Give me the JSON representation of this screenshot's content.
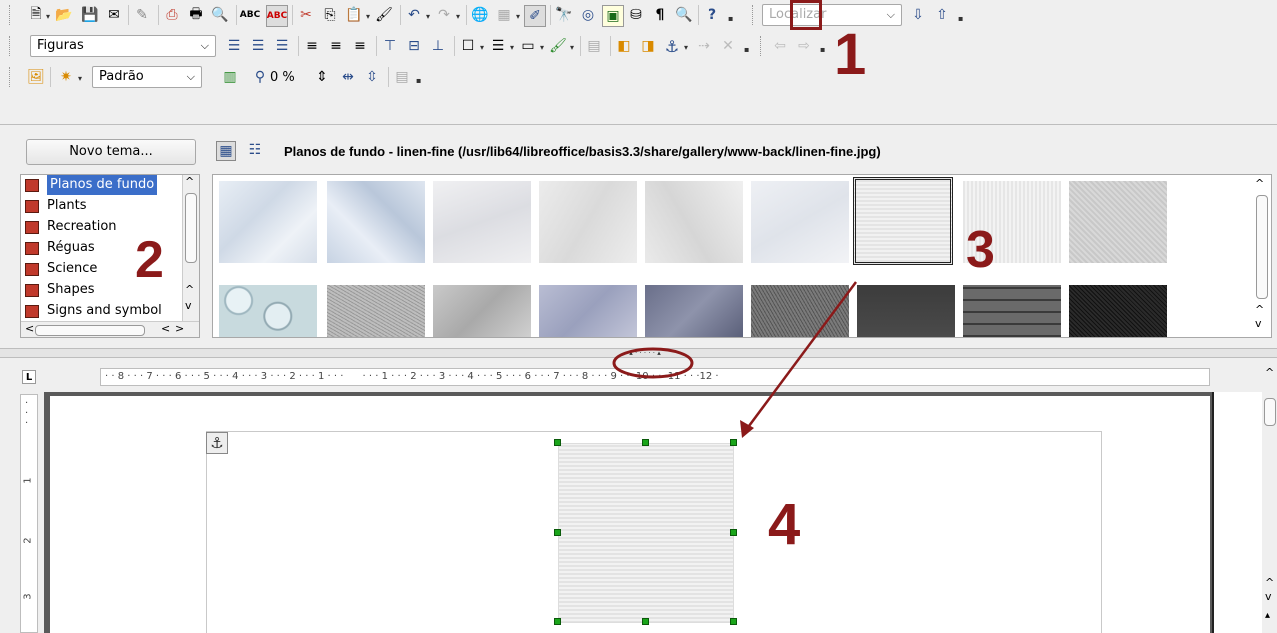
{
  "toolbar_standard": {
    "find_placeholder": "Localizar"
  },
  "toolbar_frame": {
    "style_value": "Figuras"
  },
  "toolbar_image": {
    "filter_value": "Padrão",
    "transparency_value": "0 %"
  },
  "gallery": {
    "new_theme_label": "Novo tema...",
    "path_title": "Planos de fundo - linen-fine (/usr/lib64/libreoffice/basis3.3/share/gallery/www-back/linen-fine.jpg)",
    "themes": [
      "Planos de fundo",
      "Plants",
      "Recreation",
      "Réguas",
      "Science",
      "Shapes",
      "Signs and symbol"
    ],
    "selected_theme": "Planos de fundo",
    "selected_thumb_index": 6
  },
  "ruler": {
    "ticks": "· · 8 · · · 7 · · · 6 · · · 5 · · · 4 · · · 3 · · · 2 · · · 1 · · ·      · · · 1 · · · 2 · · · 3 · · · 4 · · · 5 · · · 6 · · · 7 · · · 8 · · · 9 · · ·10 · · ·11 · · ·12 ·",
    "vertical_numbers": [
      "1",
      "2",
      "3"
    ]
  },
  "annotations": {
    "label_1": "1",
    "label_2": "2",
    "label_3": "3",
    "label_4": "4",
    "color": "#8b1a1a"
  },
  "colors": {
    "selection_blue": "#3b6ec9",
    "handle_green": "#1aa51a"
  }
}
